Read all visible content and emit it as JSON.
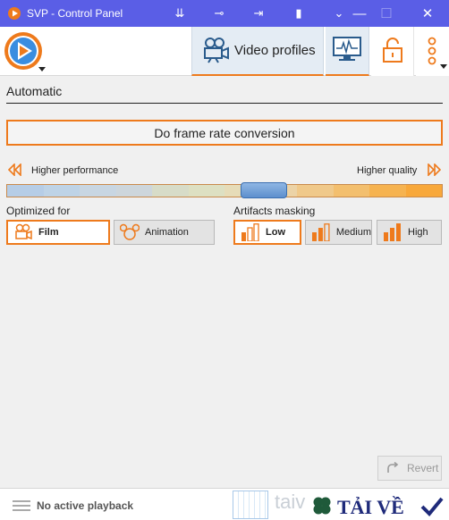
{
  "window": {
    "title": "SVP - Control Panel",
    "accent": "#ee7a1c",
    "titlebar_color": "#5a5ee6"
  },
  "toolbar": {
    "logo": "svp-logo-icon",
    "tabs": [
      {
        "label": "Video profiles",
        "icon": "video-camera-icon",
        "active": true
      },
      {
        "icon": "monitor-icon"
      },
      {
        "icon": "lock-icon"
      },
      {
        "icon": "more-vertical-icon"
      }
    ]
  },
  "profile": {
    "name": "Automatic",
    "frc_button": "Do frame rate conversion",
    "performance_label": "Higher performance",
    "quality_label": "Higher quality",
    "quality_slider": {
      "level": 0.59
    }
  },
  "optimized_for": {
    "label": "Optimized for",
    "options": [
      {
        "label": "Film",
        "selected": true
      },
      {
        "label": "Animation",
        "selected": false
      }
    ]
  },
  "artifacts_masking": {
    "label": "Artifacts masking",
    "options": [
      {
        "label": "Low",
        "selected": true
      },
      {
        "label": "Medium",
        "selected": false
      },
      {
        "label": "High",
        "selected": false
      }
    ]
  },
  "revert_button": "Revert",
  "status": {
    "text": "No active playback"
  },
  "watermark": {
    "faint": "taiv",
    "brand": "TẢI VỀ"
  }
}
